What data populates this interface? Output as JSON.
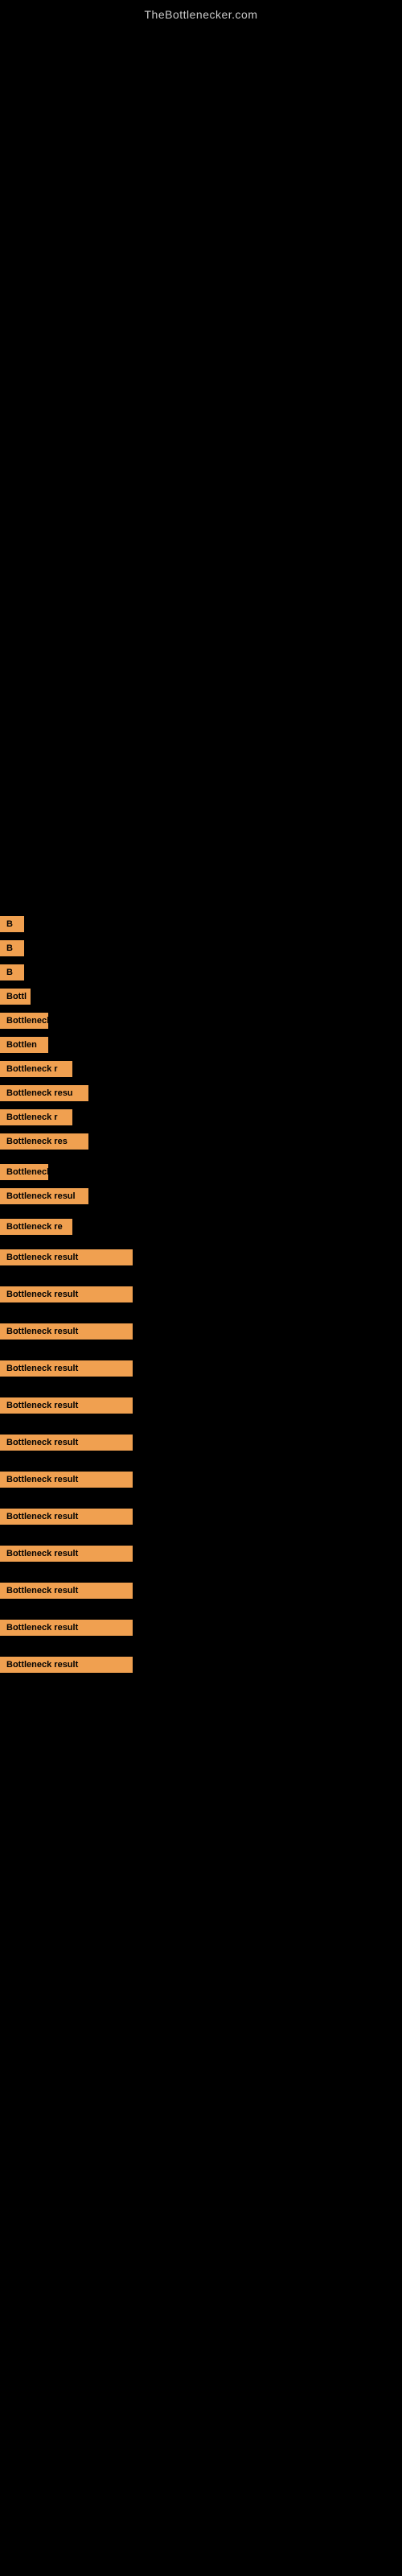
{
  "site": {
    "title": "TheBottlenecker.com"
  },
  "results": [
    {
      "id": 1,
      "label": "B",
      "badgeClass": "badge-xs",
      "gap": "small"
    },
    {
      "id": 2,
      "label": "B",
      "badgeClass": "badge-xs",
      "gap": "small"
    },
    {
      "id": 3,
      "label": "B",
      "badgeClass": "badge-xs",
      "gap": "small"
    },
    {
      "id": 4,
      "label": "Bottl",
      "badgeClass": "badge-sm",
      "gap": "small"
    },
    {
      "id": 5,
      "label": "Bottleneck",
      "badgeClass": "badge-md",
      "gap": "small"
    },
    {
      "id": 6,
      "label": "Bottlen",
      "badgeClass": "badge-md",
      "gap": "small"
    },
    {
      "id": 7,
      "label": "Bottleneck r",
      "badgeClass": "badge-lg",
      "gap": "small"
    },
    {
      "id": 8,
      "label": "Bottleneck resu",
      "badgeClass": "badge-xl",
      "gap": "small"
    },
    {
      "id": 9,
      "label": "Bottleneck r",
      "badgeClass": "badge-lg",
      "gap": "small"
    },
    {
      "id": 10,
      "label": "Bottleneck res",
      "badgeClass": "badge-xl",
      "gap": "medium"
    },
    {
      "id": 11,
      "label": "Bottleneck",
      "badgeClass": "badge-md",
      "gap": "small"
    },
    {
      "id": 12,
      "label": "Bottleneck resul",
      "badgeClass": "badge-xl",
      "gap": "medium"
    },
    {
      "id": 13,
      "label": "Bottleneck re",
      "badgeClass": "badge-lg",
      "gap": "medium"
    },
    {
      "id": 14,
      "label": "Bottleneck result",
      "badgeClass": "badge-full",
      "gap": "large"
    },
    {
      "id": 15,
      "label": "Bottleneck result",
      "badgeClass": "badge-full",
      "gap": "large"
    },
    {
      "id": 16,
      "label": "Bottleneck result",
      "badgeClass": "badge-full",
      "gap": "large"
    },
    {
      "id": 17,
      "label": "Bottleneck result",
      "badgeClass": "badge-full",
      "gap": "large"
    },
    {
      "id": 18,
      "label": "Bottleneck result",
      "badgeClass": "badge-full",
      "gap": "large"
    },
    {
      "id": 19,
      "label": "Bottleneck result",
      "badgeClass": "badge-full",
      "gap": "large"
    },
    {
      "id": 20,
      "label": "Bottleneck result",
      "badgeClass": "badge-full",
      "gap": "large"
    },
    {
      "id": 21,
      "label": "Bottleneck result",
      "badgeClass": "badge-full",
      "gap": "large"
    },
    {
      "id": 22,
      "label": "Bottleneck result",
      "badgeClass": "badge-full",
      "gap": "large"
    },
    {
      "id": 23,
      "label": "Bottleneck result",
      "badgeClass": "badge-full",
      "gap": "large"
    },
    {
      "id": 24,
      "label": "Bottleneck result",
      "badgeClass": "badge-full",
      "gap": "large"
    },
    {
      "id": 25,
      "label": "Bottleneck result",
      "badgeClass": "badge-full",
      "gap": "large"
    }
  ]
}
